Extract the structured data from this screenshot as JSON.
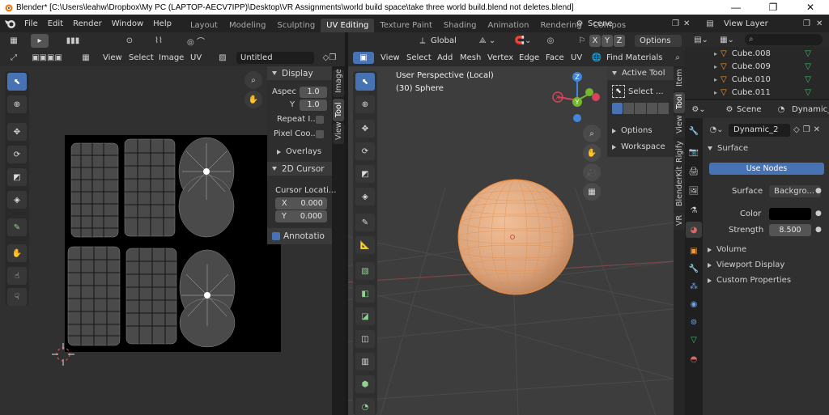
{
  "window": {
    "title": "Blender* [C:\\Users\\leahw\\Dropbox\\My PC (LAPTOP-AECV7IPP)\\Desktop\\VR Assignments\\world build space\\take three world build.blend not deletes.blend]",
    "minimize": "—",
    "maximize": "❐",
    "close": "✕"
  },
  "menu": [
    "File",
    "Edit",
    "Render",
    "Window",
    "Help"
  ],
  "workspaces": [
    "Layout",
    "Modeling",
    "Sculpting",
    "UV Editing",
    "Texture Paint",
    "Shading",
    "Animation",
    "Rendering",
    "Compos"
  ],
  "active_workspace": "UV Editing",
  "scene": {
    "label": "Scene",
    "view_layer": "View Layer"
  },
  "uv_editor": {
    "menus": [
      "View",
      "Select",
      "Image",
      "UV"
    ],
    "image_name": "Untitled",
    "display_panel": {
      "title": "Display",
      "aspect_label": "Aspec",
      "aspect_x": "1.0",
      "y_label": "Y",
      "aspect_y": "1.0",
      "repeat_label": "Repeat I...",
      "pixel_label": "Pixel Coo...",
      "overlays_label": "Overlays"
    },
    "cursor_panel": {
      "title": "2D Cursor",
      "location_label": "Cursor Locati...",
      "x_label": "X",
      "x_value": "0.000",
      "y_label": "Y",
      "y_value": "0.000"
    },
    "annotation_label": "Annotatio",
    "side_tabs": [
      "Image",
      "Tool",
      "View"
    ]
  },
  "viewport": {
    "transform": "Global",
    "axes": [
      "X",
      "Y",
      "Z"
    ],
    "options_label": "Options",
    "menus": [
      "View",
      "Select",
      "Add",
      "Mesh",
      "Vertex",
      "Edge",
      "Face",
      "UV"
    ],
    "find_materials": "Find Materials",
    "perspective_text": "User Perspective (Local)",
    "object_text": "(30) Sphere",
    "active_tool_title": "Active Tool",
    "select_tool": "Select ...",
    "options_section": "Options",
    "workspace_section": "Workspace",
    "side_tabs": [
      "Item",
      "Tool",
      "View",
      "Rigify",
      "BlenderKit",
      "VR"
    ],
    "gizmo": {
      "x": "X",
      "y": "Y",
      "z": "Z"
    }
  },
  "outliner": {
    "items": [
      "Cube.008",
      "Cube.009",
      "Cube.010",
      "Cube.011"
    ]
  },
  "properties": {
    "scene_label": "Scene",
    "world_label": "Dynamic_2",
    "world_name": "Dynamic_2",
    "surface_section": "Surface",
    "use_nodes": "Use Nodes",
    "surface_label": "Surface",
    "surface_value": "Backgro...",
    "color_label": "Color",
    "strength_label": "Strength",
    "strength_value": "8.500",
    "sections": [
      "Volume",
      "Viewport Display",
      "Custom Properties"
    ]
  },
  "colors": {
    "accent_blue": "#4772b3",
    "sphere": "#d9a37c",
    "wire_orange": "#e8883a",
    "axis_x": "#d6455a",
    "axis_y": "#74b72f",
    "axis_z": "#3f86dc"
  }
}
